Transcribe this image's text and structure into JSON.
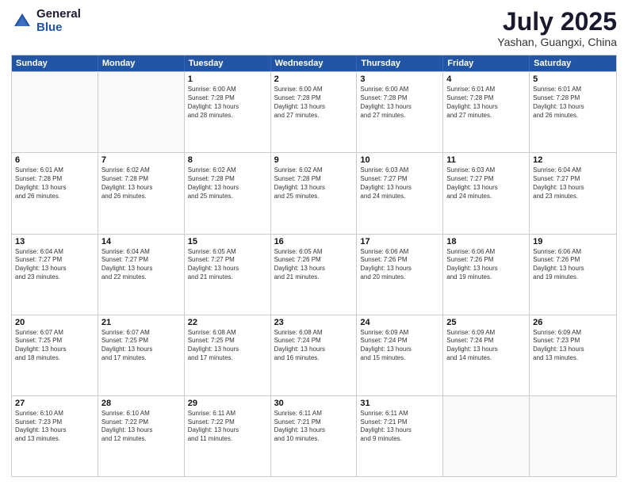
{
  "logo": {
    "general": "General",
    "blue": "Blue"
  },
  "title": "July 2025",
  "subtitle": "Yashan, Guangxi, China",
  "header_days": [
    "Sunday",
    "Monday",
    "Tuesday",
    "Wednesday",
    "Thursday",
    "Friday",
    "Saturday"
  ],
  "rows": [
    [
      {
        "day": "",
        "empty": true
      },
      {
        "day": "",
        "empty": true
      },
      {
        "day": "1",
        "lines": [
          "Sunrise: 6:00 AM",
          "Sunset: 7:28 PM",
          "Daylight: 13 hours",
          "and 28 minutes."
        ]
      },
      {
        "day": "2",
        "lines": [
          "Sunrise: 6:00 AM",
          "Sunset: 7:28 PM",
          "Daylight: 13 hours",
          "and 27 minutes."
        ]
      },
      {
        "day": "3",
        "lines": [
          "Sunrise: 6:00 AM",
          "Sunset: 7:28 PM",
          "Daylight: 13 hours",
          "and 27 minutes."
        ]
      },
      {
        "day": "4",
        "lines": [
          "Sunrise: 6:01 AM",
          "Sunset: 7:28 PM",
          "Daylight: 13 hours",
          "and 27 minutes."
        ]
      },
      {
        "day": "5",
        "lines": [
          "Sunrise: 6:01 AM",
          "Sunset: 7:28 PM",
          "Daylight: 13 hours",
          "and 26 minutes."
        ]
      }
    ],
    [
      {
        "day": "6",
        "lines": [
          "Sunrise: 6:01 AM",
          "Sunset: 7:28 PM",
          "Daylight: 13 hours",
          "and 26 minutes."
        ]
      },
      {
        "day": "7",
        "lines": [
          "Sunrise: 6:02 AM",
          "Sunset: 7:28 PM",
          "Daylight: 13 hours",
          "and 26 minutes."
        ]
      },
      {
        "day": "8",
        "lines": [
          "Sunrise: 6:02 AM",
          "Sunset: 7:28 PM",
          "Daylight: 13 hours",
          "and 25 minutes."
        ]
      },
      {
        "day": "9",
        "lines": [
          "Sunrise: 6:02 AM",
          "Sunset: 7:28 PM",
          "Daylight: 13 hours",
          "and 25 minutes."
        ]
      },
      {
        "day": "10",
        "lines": [
          "Sunrise: 6:03 AM",
          "Sunset: 7:27 PM",
          "Daylight: 13 hours",
          "and 24 minutes."
        ]
      },
      {
        "day": "11",
        "lines": [
          "Sunrise: 6:03 AM",
          "Sunset: 7:27 PM",
          "Daylight: 13 hours",
          "and 24 minutes."
        ]
      },
      {
        "day": "12",
        "lines": [
          "Sunrise: 6:04 AM",
          "Sunset: 7:27 PM",
          "Daylight: 13 hours",
          "and 23 minutes."
        ]
      }
    ],
    [
      {
        "day": "13",
        "lines": [
          "Sunrise: 6:04 AM",
          "Sunset: 7:27 PM",
          "Daylight: 13 hours",
          "and 23 minutes."
        ]
      },
      {
        "day": "14",
        "lines": [
          "Sunrise: 6:04 AM",
          "Sunset: 7:27 PM",
          "Daylight: 13 hours",
          "and 22 minutes."
        ]
      },
      {
        "day": "15",
        "lines": [
          "Sunrise: 6:05 AM",
          "Sunset: 7:27 PM",
          "Daylight: 13 hours",
          "and 21 minutes."
        ]
      },
      {
        "day": "16",
        "lines": [
          "Sunrise: 6:05 AM",
          "Sunset: 7:26 PM",
          "Daylight: 13 hours",
          "and 21 minutes."
        ]
      },
      {
        "day": "17",
        "lines": [
          "Sunrise: 6:06 AM",
          "Sunset: 7:26 PM",
          "Daylight: 13 hours",
          "and 20 minutes."
        ]
      },
      {
        "day": "18",
        "lines": [
          "Sunrise: 6:06 AM",
          "Sunset: 7:26 PM",
          "Daylight: 13 hours",
          "and 19 minutes."
        ]
      },
      {
        "day": "19",
        "lines": [
          "Sunrise: 6:06 AM",
          "Sunset: 7:26 PM",
          "Daylight: 13 hours",
          "and 19 minutes."
        ]
      }
    ],
    [
      {
        "day": "20",
        "lines": [
          "Sunrise: 6:07 AM",
          "Sunset: 7:25 PM",
          "Daylight: 13 hours",
          "and 18 minutes."
        ]
      },
      {
        "day": "21",
        "lines": [
          "Sunrise: 6:07 AM",
          "Sunset: 7:25 PM",
          "Daylight: 13 hours",
          "and 17 minutes."
        ]
      },
      {
        "day": "22",
        "lines": [
          "Sunrise: 6:08 AM",
          "Sunset: 7:25 PM",
          "Daylight: 13 hours",
          "and 17 minutes."
        ]
      },
      {
        "day": "23",
        "lines": [
          "Sunrise: 6:08 AM",
          "Sunset: 7:24 PM",
          "Daylight: 13 hours",
          "and 16 minutes."
        ]
      },
      {
        "day": "24",
        "lines": [
          "Sunrise: 6:09 AM",
          "Sunset: 7:24 PM",
          "Daylight: 13 hours",
          "and 15 minutes."
        ]
      },
      {
        "day": "25",
        "lines": [
          "Sunrise: 6:09 AM",
          "Sunset: 7:24 PM",
          "Daylight: 13 hours",
          "and 14 minutes."
        ]
      },
      {
        "day": "26",
        "lines": [
          "Sunrise: 6:09 AM",
          "Sunset: 7:23 PM",
          "Daylight: 13 hours",
          "and 13 minutes."
        ]
      }
    ],
    [
      {
        "day": "27",
        "lines": [
          "Sunrise: 6:10 AM",
          "Sunset: 7:23 PM",
          "Daylight: 13 hours",
          "and 13 minutes."
        ]
      },
      {
        "day": "28",
        "lines": [
          "Sunrise: 6:10 AM",
          "Sunset: 7:22 PM",
          "Daylight: 13 hours",
          "and 12 minutes."
        ]
      },
      {
        "day": "29",
        "lines": [
          "Sunrise: 6:11 AM",
          "Sunset: 7:22 PM",
          "Daylight: 13 hours",
          "and 11 minutes."
        ]
      },
      {
        "day": "30",
        "lines": [
          "Sunrise: 6:11 AM",
          "Sunset: 7:21 PM",
          "Daylight: 13 hours",
          "and 10 minutes."
        ]
      },
      {
        "day": "31",
        "lines": [
          "Sunrise: 6:11 AM",
          "Sunset: 7:21 PM",
          "Daylight: 13 hours",
          "and 9 minutes."
        ]
      },
      {
        "day": "",
        "empty": true
      },
      {
        "day": "",
        "empty": true
      }
    ]
  ]
}
